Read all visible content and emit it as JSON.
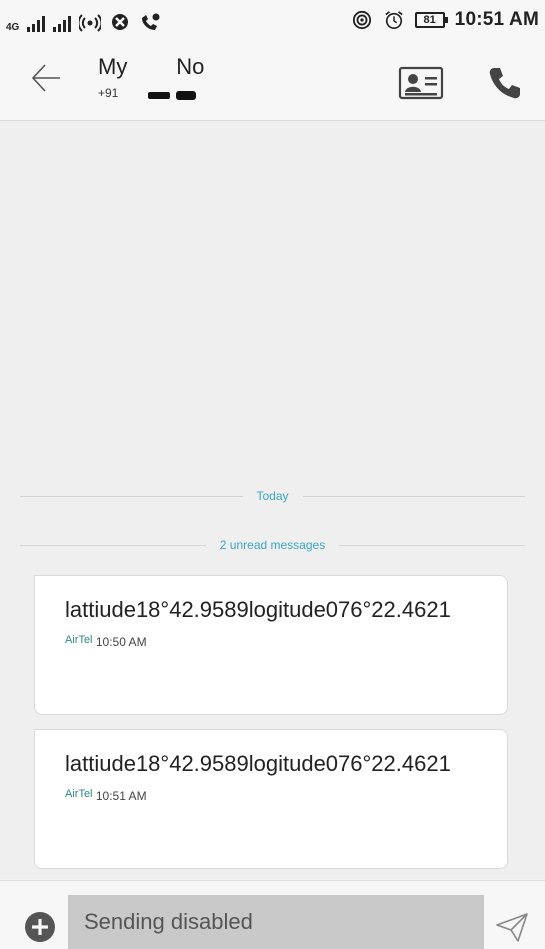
{
  "status_bar": {
    "network_label": "4G",
    "battery_level": "81",
    "time": "10:51 AM"
  },
  "header": {
    "contact_name": "My        No",
    "contact_number_prefix": "+91"
  },
  "conversation": {
    "date_divider": "Today",
    "unread_divider": "2 unread messages",
    "messages": [
      {
        "body": "lattiude18°42.9589logitude076°22.4621",
        "sim": "AirTel",
        "time": "10:50 AM"
      },
      {
        "body": "lattiude18°42.9589logitude076°22.4621",
        "sim": "AirTel",
        "time": "10:51 AM"
      }
    ]
  },
  "composer": {
    "input_text": "Sending disabled"
  },
  "colors": {
    "accent": "#38a8c8",
    "sim_label": "#2b8a86",
    "input_background": "#c9c9c9"
  },
  "icons": [
    "signal-icon",
    "hotspot-icon",
    "blocked-icon",
    "call-status-icon",
    "nfc-icon",
    "alarm-icon",
    "battery-icon",
    "back-arrow-icon",
    "contact-card-icon",
    "phone-icon",
    "add-icon",
    "send-icon"
  ]
}
